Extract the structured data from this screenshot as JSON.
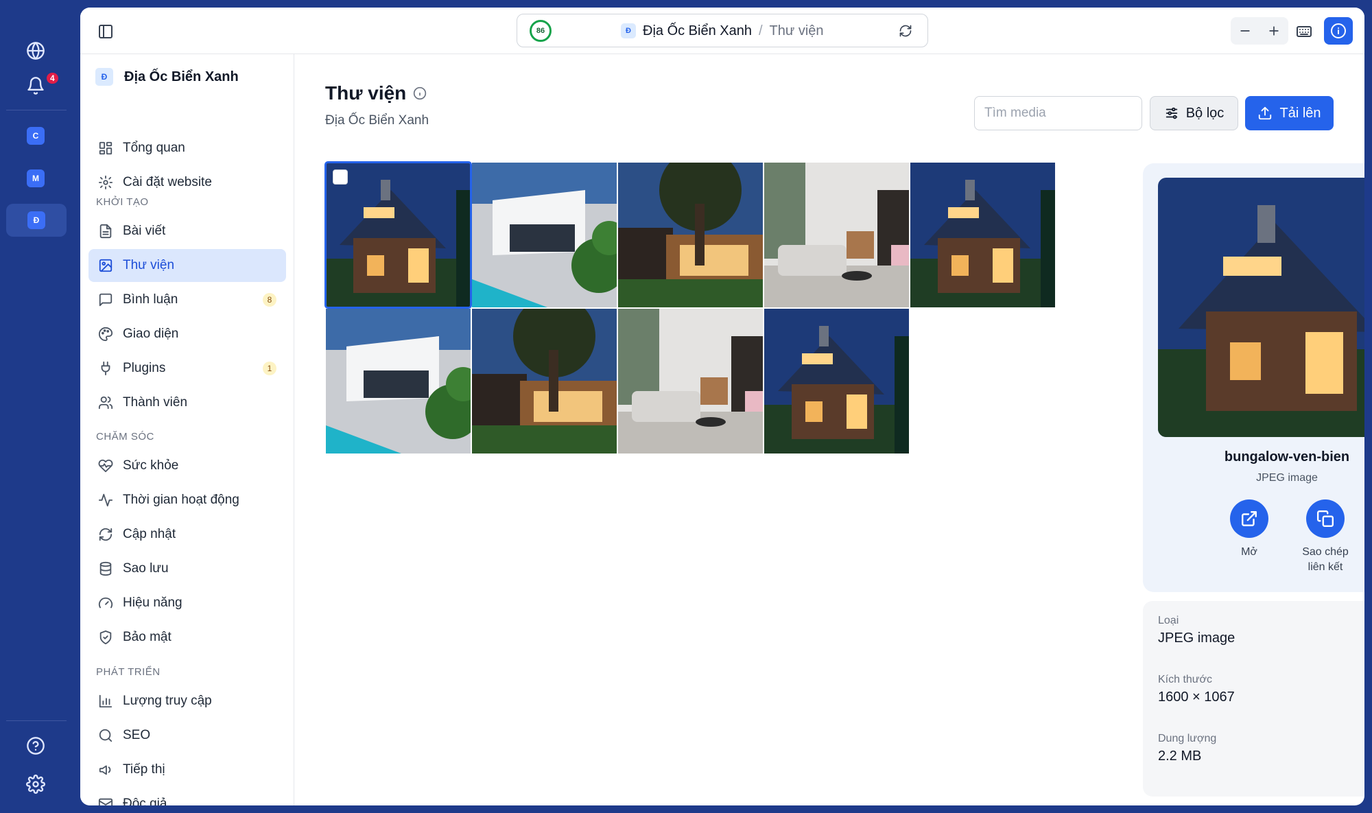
{
  "rail": {
    "notification_count": "4",
    "workspaces": [
      "C",
      "M",
      "Đ"
    ]
  },
  "addressbar": {
    "score": "86",
    "site_initial": "Đ",
    "site": "Địa Ốc Biển Xanh",
    "separator": "/",
    "current": "Thư viện"
  },
  "sidebar": {
    "site_initial": "Đ",
    "site_name": "Địa Ốc Biển Xanh",
    "top_items": [
      {
        "label": "Tổng quan",
        "icon": "dashboard-icon"
      },
      {
        "label": "Cài đặt website",
        "icon": "gear-icon"
      }
    ],
    "sections": [
      {
        "title": "KHỞI TẠO",
        "items": [
          {
            "label": "Bài viết",
            "icon": "document-icon"
          },
          {
            "label": "Thư viện",
            "icon": "image-icon",
            "active": true
          },
          {
            "label": "Bình luận",
            "icon": "comment-icon",
            "count": "8"
          },
          {
            "label": "Giao diện",
            "icon": "palette-icon"
          },
          {
            "label": "Plugins",
            "icon": "plug-icon",
            "count": "1"
          },
          {
            "label": "Thành viên",
            "icon": "users-icon"
          }
        ]
      },
      {
        "title": "CHĂM SÓC",
        "items": [
          {
            "label": "Sức khỏe",
            "icon": "heart-pulse-icon"
          },
          {
            "label": "Thời gian hoạt động",
            "icon": "activity-icon"
          },
          {
            "label": "Cập nhật",
            "icon": "refresh-icon"
          },
          {
            "label": "Sao lưu",
            "icon": "database-icon"
          },
          {
            "label": "Hiệu năng",
            "icon": "gauge-icon"
          },
          {
            "label": "Bảo mật",
            "icon": "shield-icon"
          }
        ]
      },
      {
        "title": "PHÁT TRIỂN",
        "items": [
          {
            "label": "Lượng truy cập",
            "icon": "bar-chart-icon"
          },
          {
            "label": "SEO",
            "icon": "search-icon"
          },
          {
            "label": "Tiếp thị",
            "icon": "megaphone-icon"
          },
          {
            "label": "Độc giả",
            "icon": "mail-icon"
          }
        ]
      }
    ]
  },
  "main": {
    "title": "Thư viện",
    "subtitle": "Địa Ốc Biển Xanh",
    "search_placeholder": "Tìm media",
    "filter_label": "Bộ lọc",
    "upload_label": "Tải lên",
    "media": [
      "house-night",
      "white-villa",
      "tree-house",
      "living-room",
      "house-night",
      "white-villa",
      "tree-house",
      "living-room",
      "house-night"
    ]
  },
  "detail": {
    "name": "bungalow-ven-bien",
    "type": "JPEG image",
    "open_label": "Mở",
    "copy_label_line1": "Sao chép",
    "copy_label_line2": "liên kết",
    "meta": [
      {
        "key": "Loại",
        "value": "JPEG image"
      },
      {
        "key": "Kích thước",
        "value": "1600 × 1067"
      },
      {
        "key": "Dung lượng",
        "value": "2.2 MB"
      }
    ]
  },
  "colors": {
    "accent": "#2563eb",
    "rail": "#1e3a8a",
    "active_bg": "#dbe7fd",
    "count_badge": "#fdf3c4"
  }
}
